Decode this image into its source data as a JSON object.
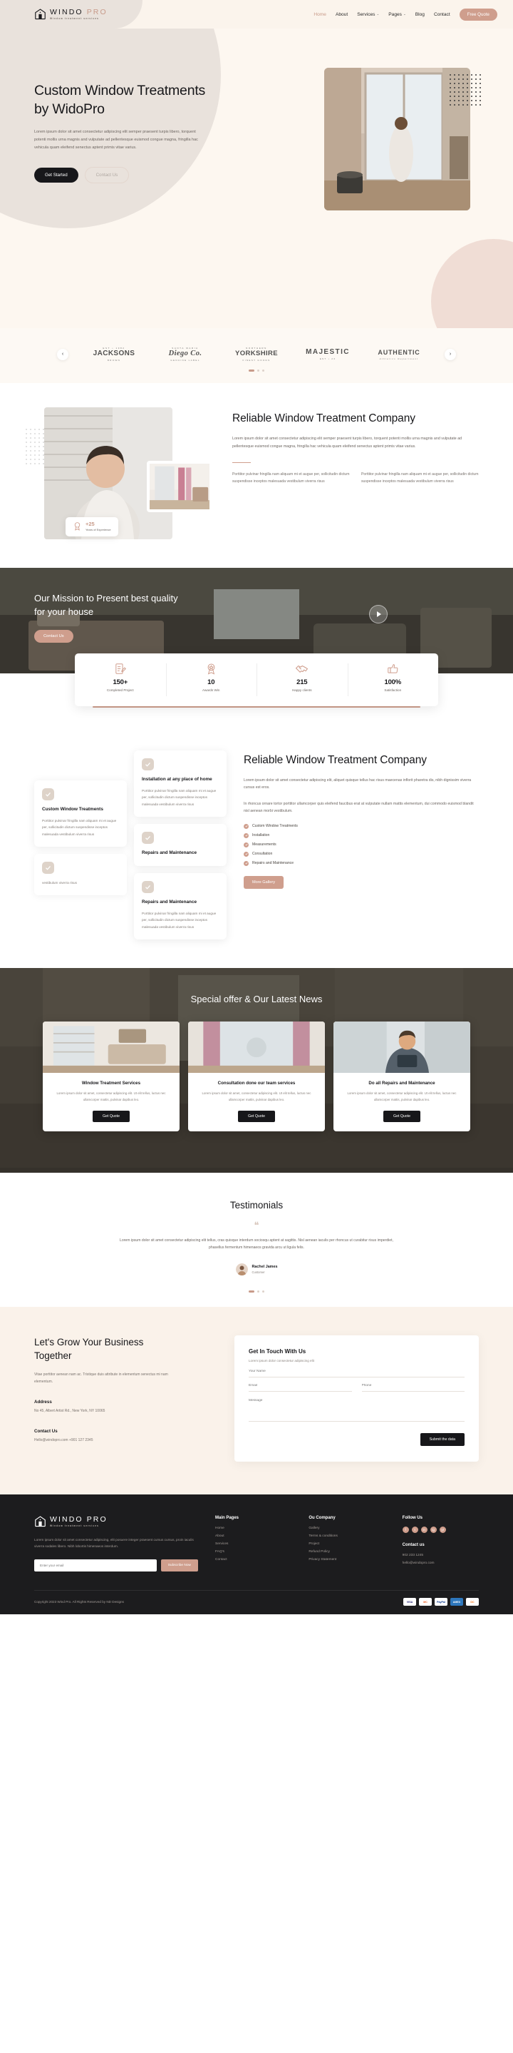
{
  "brand": {
    "name_main": "WINDO",
    "name_accent": "PRO",
    "tagline": "Window treatment services"
  },
  "header": {
    "nav": [
      {
        "label": "Home",
        "active": true
      },
      {
        "label": "About",
        "active": false
      },
      {
        "label": "Services",
        "active": false,
        "caret": "⌄"
      },
      {
        "label": "Pages",
        "active": false,
        "caret": "⌄"
      },
      {
        "label": "Blog",
        "active": false
      },
      {
        "label": "Contact",
        "active": false
      }
    ],
    "cta": "Free Quote"
  },
  "hero": {
    "title": "Custom Window Treatments by WidoPro",
    "body": "Lorem ipsum dolor sit amet consectetur adipiscing elit semper praesent turpis libero, torquent potenti mollis urna magnis and vulputate ad pellentesque euismod congue magna, fringilla hac vehicula quam eleifend senectus aptent primis vitae varius.",
    "btn_primary": "Get Started",
    "btn_secondary": "Contact Us"
  },
  "logostrip": {
    "prev": "‹",
    "next": "›",
    "brands": [
      {
        "top": "EST • 1982",
        "main": "JACKSONS",
        "sub": "BROWN",
        "size": "10"
      },
      {
        "top": "SANTA MARIA",
        "main": "Diego Co.",
        "sub": "GENUINE LABEL",
        "size": "10.5"
      },
      {
        "top": "NORTHERN",
        "main": "YORKSHIRE",
        "sub": "FINEST GOODS",
        "size": "9.5"
      },
      {
        "top": "",
        "main": "MAJESTIC",
        "sub": "EST • 23",
        "size": "10"
      },
      {
        "top": "",
        "main": "AUTHENTIC",
        "sub": "Athletics Department",
        "size": "9"
      }
    ]
  },
  "reliable": {
    "title": "Reliable Window Treatment Company",
    "body": "Lorem ipsum dolor sit amet consectetur adipiscing elit semper praesent turpis libero, torquent potenti mollis urna magnis and vulputate ad pellentesque euismod congue magna, fringilla hac vehicula quam eleifend senectus aptent primis vitae varius.",
    "col_left": "Porttitor pulvinar fringilla nam aliquam mi et augue per, sollicitudin dictum suspendisse inceptos malesuada vestibulum viverra risus",
    "col_right": "Porttitor pulvinar fringilla nam aliquam mi et augue per, sollicitudin dictum suspendisse inceptos malesuada vestibulum viverra risus",
    "exp_num": "+25",
    "exp_label": "Years of Experience"
  },
  "mission": {
    "title": "Our Mission to Present best quality for your house",
    "cta": "Contact Us"
  },
  "stats": [
    {
      "num": "150+",
      "label": "Completed Project",
      "icon": "document-pencil-icon"
    },
    {
      "num": "10",
      "label": "Awards Win",
      "icon": "award-badge-icon"
    },
    {
      "num": "215",
      "label": "Happy clients",
      "icon": "handshake-icon"
    },
    {
      "num": "100%",
      "label": "Satisfaction",
      "icon": "thumbs-up-icon"
    }
  ],
  "features": {
    "cards": [
      {
        "title": "Custom Window Treatments",
        "body": ""
      },
      {
        "title": "Installation at any place of home",
        "body": "Porttitor pulvinar fringilla nam aliquam mi et augue per, sollicitudin dictum suspendisse inceptos malesuada vestibulum viverra risus"
      },
      {
        "title": "",
        "body": "vestibulum viverra risus"
      },
      {
        "title": "Repairs and Maintenance",
        "body": ""
      },
      {
        "title": "Repairs and Maintenance",
        "body": "Porttitor pulvinar fringilla nam aliquam mi et augue per, sollicitudin dictum suspendisse inceptos malesuada vestibulum viverra risus"
      }
    ],
    "title": "Reliable Window Treatment Company",
    "body1": "Lorem ipsum dolor sit amet consectetur adipiscing elit, aliquet quisque tellus hac risus maecenas inflorit pharetra dis, nibh dignissim viverra cursus est eros.",
    "body2": "In rhoncus ornare tortor porttitor ullamcorper quis eleifend faucibus erat at vulputate nullam mattis elementum, dui commodo euismod blandit nisl aenean morbi vestibulum.",
    "checklist": [
      "Custom Window Treatments",
      "Installation",
      "Measurements",
      "Consultation",
      "Repairs and Maintenance"
    ],
    "cta": "More Gallery"
  },
  "offers": {
    "title": "Special offer & Our Latest News",
    "cards": [
      {
        "title": "Window Treatment Services",
        "body": "Lorem ipsum dolor sit amet, consectetur adipiscing elit. Ut elit tellus, luctus nec ullamcorper mattis, pulvinar dapibus leo.",
        "cta": "Get Quote",
        "pic": "living-room-blinds"
      },
      {
        "title": "Consultation done our team services",
        "body": "Lorem ipsum dolor sit amet, consectetur adipiscing elit. Ut elit tellus, luctus nec ullamcorper mattis, pulvinar dapibus leo.",
        "cta": "Get Quote",
        "pic": "window-curtain"
      },
      {
        "title": "Do all Repairs and Maintenance",
        "body": "Lorem ipsum dolor sit amet, consectetur adipiscing elit. Ut elit tellus, luctus nec ullamcorper mattis, pulvinar dapibus leo.",
        "cta": "Get Quote",
        "pic": "worker-installing"
      }
    ]
  },
  "testimonials": {
    "title": "Testimonials",
    "quote_glyph": "❝",
    "body": "Lorem ipsum dolor sit amet consectetur adipiscing elit tellus, cras quisque interdum sociosqu aptent at sagittis. Nisl aenean iaculis per rhoncus ut curabitur risus imperdiet, phasellus fermentum himenaeos gravida arcu ut ligula felis.",
    "person_name": "Rachel James",
    "person_role": "Customer",
    "prev": "‹",
    "next": "›"
  },
  "contact": {
    "title": "Let's Grow Your Business Together",
    "intro": "Vitae porttitor aenean nam ac. Tristique duis attribute in elementum senectus mi nam elementum.",
    "address_title": "Address",
    "address": "No 45, Albert Artist Rd., New York, NY 10065",
    "contact_title": "Contact Us",
    "contact_value": "Hello@windopro.com  +901 127 2345",
    "form_title": "Get In Touch With Us",
    "form_sub": "Lorem ipsum dolor consectetur adipiscing elit",
    "ph_name": "Your Name",
    "ph_email": "Email",
    "ph_phone": "Phone",
    "ph_message": "Message",
    "submit": "Submit the data"
  },
  "footer": {
    "desc": "Lorem ipsum dolor sit amet consectetur adipiscing, elit posuere integer praesent cursus cursus, proin iaculis viverra sodales libero. Nibh lobortis himenaeos interdum.",
    "ph_email": "Enter your email",
    "btn": "Subscribe Now",
    "col_main_title": "Main Pages",
    "col_main": [
      "Home",
      "About",
      "Services",
      "FAQ's",
      "Contact"
    ],
    "col_company_title": "Ou Company",
    "col_company": [
      "Gallery",
      "Terms & conditions",
      "Project",
      "Refund Policy",
      "Privacy Statement"
    ],
    "col_follow_title": "Follow Us",
    "socials": [
      "f",
      "t",
      "in",
      "ig",
      "yt"
    ],
    "contact_title": "Contact us",
    "contact_lines": [
      "902 233 1245",
      "hello@windopro.com"
    ],
    "copyright": "Copyright 2023 Wind Pro. All Rights Reserved by ND Designs",
    "payments": [
      "VISA",
      "MC",
      "PayPal",
      "AMEX",
      "DC"
    ]
  }
}
